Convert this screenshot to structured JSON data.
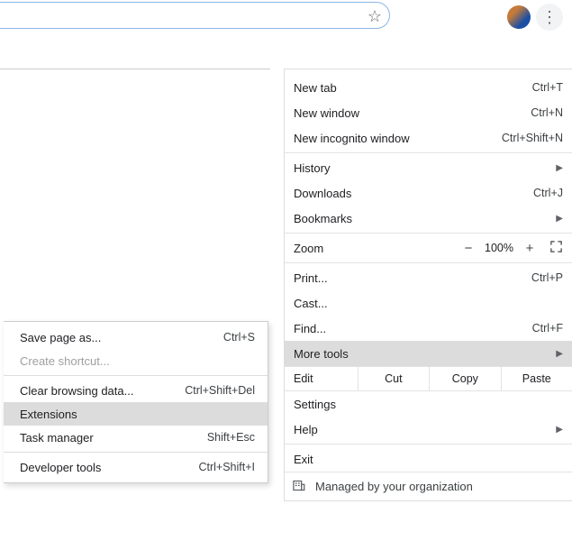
{
  "address_bar": {
    "value": ""
  },
  "menu": {
    "new_tab": {
      "label": "New tab",
      "shortcut": "Ctrl+T"
    },
    "new_window": {
      "label": "New window",
      "shortcut": "Ctrl+N"
    },
    "incognito": {
      "label": "New incognito window",
      "shortcut": "Ctrl+Shift+N"
    },
    "history": {
      "label": "History",
      "shortcut": ""
    },
    "downloads": {
      "label": "Downloads",
      "shortcut": "Ctrl+J"
    },
    "bookmarks": {
      "label": "Bookmarks",
      "shortcut": ""
    },
    "zoom": {
      "label": "Zoom",
      "minus": "−",
      "value": "100%",
      "plus": "+"
    },
    "print": {
      "label": "Print...",
      "shortcut": "Ctrl+P"
    },
    "cast": {
      "label": "Cast...",
      "shortcut": ""
    },
    "find": {
      "label": "Find...",
      "shortcut": "Ctrl+F"
    },
    "more_tools": {
      "label": "More tools"
    },
    "edit": {
      "label": "Edit",
      "cut": "Cut",
      "copy": "Copy",
      "paste": "Paste"
    },
    "settings": {
      "label": "Settings"
    },
    "help": {
      "label": "Help"
    },
    "exit": {
      "label": "Exit"
    },
    "managed": {
      "label": "Managed by your organization"
    }
  },
  "submenu": {
    "save_page": {
      "label": "Save page as...",
      "shortcut": "Ctrl+S"
    },
    "create_sc": {
      "label": "Create shortcut...",
      "shortcut": ""
    },
    "clear_bd": {
      "label": "Clear browsing data...",
      "shortcut": "Ctrl+Shift+Del"
    },
    "extensions": {
      "label": "Extensions",
      "shortcut": ""
    },
    "task_mgr": {
      "label": "Task manager",
      "shortcut": "Shift+Esc"
    },
    "dev_tools": {
      "label": "Developer tools",
      "shortcut": "Ctrl+Shift+I"
    }
  }
}
